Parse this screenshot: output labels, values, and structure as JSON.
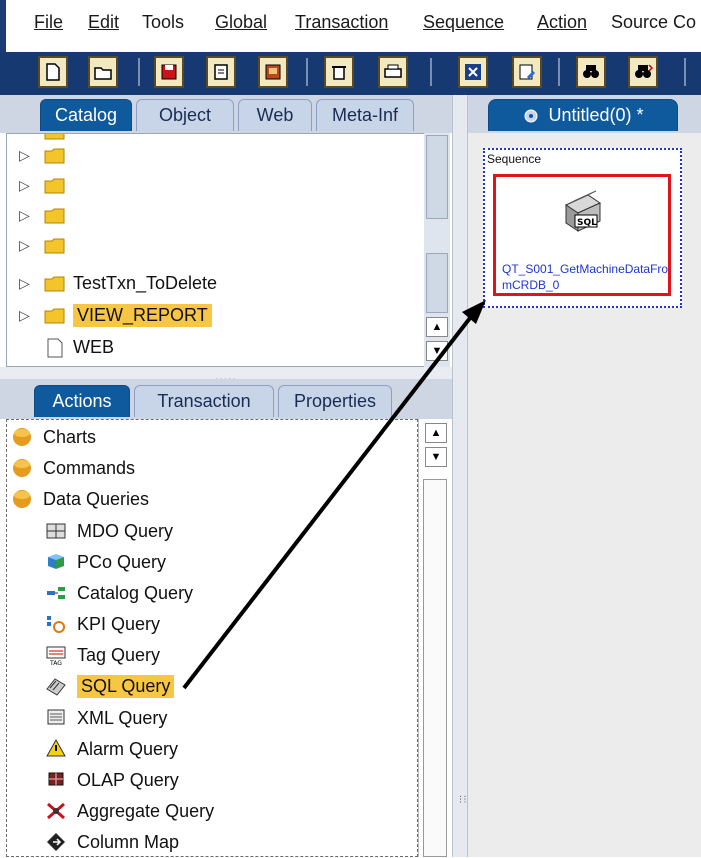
{
  "menubar": {
    "items": [
      {
        "label": "File",
        "underline": "F"
      },
      {
        "label": "Edit",
        "underline": "E"
      },
      {
        "label": "Tools",
        "underline": "o"
      },
      {
        "label": "Global",
        "underline": "G"
      },
      {
        "label": "Transaction",
        "underline": "T"
      },
      {
        "label": "Sequence",
        "underline": "S"
      },
      {
        "label": "Action",
        "underline": "A"
      },
      {
        "label": "Source Co",
        "underline": "u"
      }
    ]
  },
  "toolbar": {
    "buttons": [
      "new-document-icon",
      "open-folder-icon",
      "save-icon",
      "save-as-icon",
      "save-all-icon",
      "delete-icon",
      "print-icon",
      "close-x-icon",
      "edit-doc-icon",
      "find-icon",
      "find-next-icon"
    ]
  },
  "catalog_panel": {
    "tabs": [
      {
        "label": "Catalog",
        "active": true
      },
      {
        "label": "Object",
        "active": false
      },
      {
        "label": "Web",
        "active": false
      },
      {
        "label": "Meta-Inf",
        "active": false
      }
    ],
    "tree": [
      {
        "label": "",
        "type": "folder"
      },
      {
        "label": "",
        "type": "folder"
      },
      {
        "label": "",
        "type": "folder"
      },
      {
        "label": "",
        "type": "folder"
      },
      {
        "label": "TestTxn_ToDelete",
        "type": "folder"
      },
      {
        "label": "VIEW_REPORT",
        "type": "folder",
        "highlighted": true
      },
      {
        "label": "WEB",
        "type": "file"
      }
    ]
  },
  "actions_panel": {
    "tabs": [
      {
        "label": "Actions",
        "active": true
      },
      {
        "label": "Transaction",
        "active": false
      },
      {
        "label": "Properties",
        "active": false
      }
    ],
    "groups": [
      {
        "label": "Charts"
      },
      {
        "label": "Commands"
      },
      {
        "label": "Data Queries"
      }
    ],
    "queries": [
      {
        "label": "MDO Query",
        "icon": "mdo-query-icon"
      },
      {
        "label": "PCo Query",
        "icon": "pco-query-icon"
      },
      {
        "label": "Catalog Query",
        "icon": "catalog-query-icon"
      },
      {
        "label": "KPI Query",
        "icon": "kpi-query-icon"
      },
      {
        "label": "Tag Query",
        "icon": "tag-query-icon"
      },
      {
        "label": "SQL Query",
        "icon": "sql-query-icon",
        "highlighted": true
      },
      {
        "label": "XML Query",
        "icon": "xml-query-icon"
      },
      {
        "label": "Alarm Query",
        "icon": "alarm-query-icon"
      },
      {
        "label": "OLAP Query",
        "icon": "olap-query-icon"
      },
      {
        "label": "Aggregate Query",
        "icon": "aggregate-query-icon"
      },
      {
        "label": "Column Map",
        "icon": "column-map-icon"
      }
    ]
  },
  "editor": {
    "tab_label": "Untitled(0) *",
    "sequence_label": "Sequence",
    "action_name": "QT_S001_GetMachineDataFromCRDB_0",
    "sql_badge": "SQL"
  },
  "colors": {
    "toolbar_bg": "#163972",
    "tab_active": "#0f5a9c",
    "highlight": "#f7c744",
    "action_border": "#e0141c",
    "action_name": "#1e34d6",
    "sequence_border": "#2233cc"
  }
}
